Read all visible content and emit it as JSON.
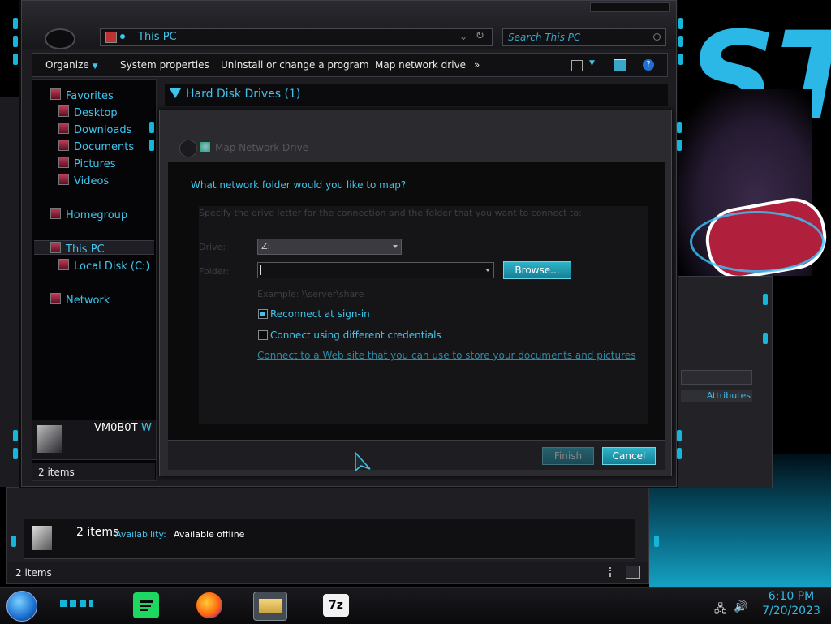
{
  "window": {
    "address": "This PC",
    "search_placeholder": "Search This PC"
  },
  "toolbar": {
    "organize": "Organize",
    "system_properties": "System properties",
    "uninstall": "Uninstall or change a program",
    "map_network_drive": "Map network drive",
    "more": "»"
  },
  "sidebar": {
    "items": [
      {
        "label": "Favorites"
      },
      {
        "label": "Desktop"
      },
      {
        "label": "Downloads"
      },
      {
        "label": "Documents"
      },
      {
        "label": "Pictures"
      },
      {
        "label": "Videos"
      },
      {
        "label": "Homegroup"
      },
      {
        "label": "This PC"
      },
      {
        "label": "Local Disk (C:)"
      },
      {
        "label": "Network"
      }
    ],
    "user_name": "VM0B0T",
    "user_suffix": "W",
    "status": "2 items"
  },
  "content": {
    "group_header": "Hard Disk Drives (1)"
  },
  "dialog": {
    "title": "Map Network Drive",
    "question": "What network folder would you like to map?",
    "hint": "Specify the drive letter for the connection and the folder that you want to connect to:",
    "drive_label": "Drive:",
    "drive_value": "Z:",
    "folder_label": "Folder:",
    "folder_value": "",
    "browse": "Browse...",
    "example": "Example: \\\\server\\share",
    "reconnect": "Reconnect at sign-in",
    "reconnect_checked": true,
    "diff_creds": "Connect using different credentials",
    "diff_creds_checked": false,
    "web_link": "Connect to a Web site that you can use to store your documents and pictures",
    "finish": "Finish",
    "cancel": "Cancel"
  },
  "window2": {
    "items_count": "2 items",
    "availability_label": "Availability:",
    "availability_value": "Available offline",
    "status": "2 items"
  },
  "background_window": {
    "attributes": "Attributes"
  },
  "taskbar": {
    "time": "6:10 PM",
    "date": "7/20/2023",
    "app_7z": "7z"
  },
  "colors": {
    "accent": "#17b5d8",
    "text_accent": "#41c3ea"
  }
}
